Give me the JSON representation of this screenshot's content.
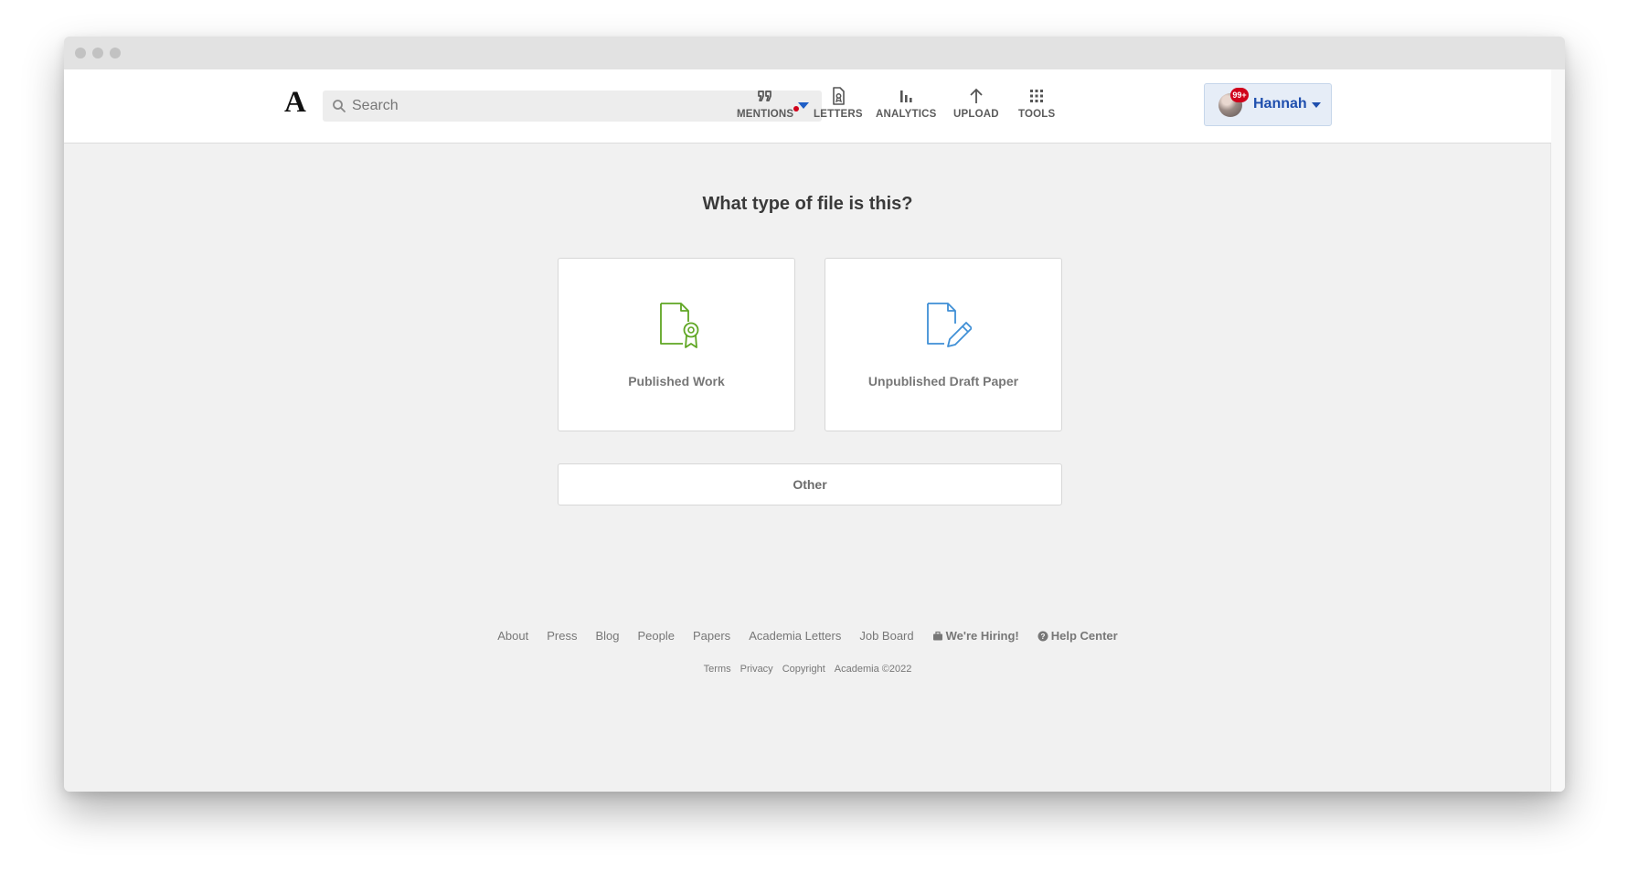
{
  "header": {
    "logo": "A",
    "search": {
      "placeholder": "Search"
    },
    "nav": {
      "mentions": "MENTIONS",
      "letters": "LETTERS",
      "analytics": "ANALYTICS",
      "upload": "UPLOAD",
      "tools": "TOOLS"
    },
    "user": {
      "name": "Hannah",
      "badge": "99+"
    }
  },
  "main": {
    "question": "What type of file is this?",
    "options": [
      {
        "label": "Published Work",
        "icon": "certified-document-icon",
        "color": "#5fa623"
      },
      {
        "label": "Unpublished Draft Paper",
        "icon": "draft-document-pencil-icon",
        "color": "#3f8fd6"
      }
    ],
    "other": "Other"
  },
  "footer": {
    "links": [
      "About",
      "Press",
      "Blog",
      "People",
      "Papers",
      "Academia Letters",
      "Job Board"
    ],
    "hiring": "We're Hiring!",
    "help": "Help Center",
    "legal": [
      "Terms",
      "Privacy",
      "Copyright"
    ],
    "copyright": "Academia ©2022"
  }
}
